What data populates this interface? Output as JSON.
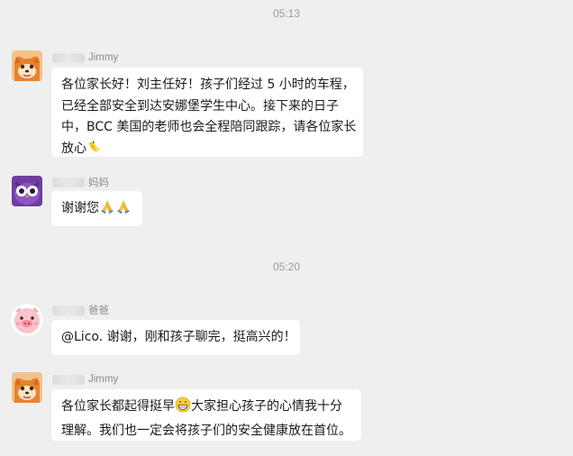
{
  "chat": {
    "timestamps": [
      "05:13",
      "05:20"
    ],
    "messages": [
      {
        "sender": "Jimmy",
        "lines": [
          "各位家长好！刘主任好！孩子们经过 5 小时的车程，",
          "已经全部安全到达安娜堡学生中心。接下来的日子",
          "中，BCC 美国的老师也会全程陪同跟踪，请各位家长",
          "放心"
        ],
        "emoji": "banana-icon"
      },
      {
        "sender": "妈妈",
        "lines": [
          "谢谢您"
        ],
        "emoji": "praying-hands-icon"
      },
      {
        "sender": "爸爸",
        "lines": [
          "@Lico. 谢谢，刚和孩子聊完，挺高兴的！"
        ]
      },
      {
        "sender": "Jimmy",
        "lines": [
          "各位家长都起得挺早",
          "大家担心孩子的心情我十分",
          "理解。我们也一定会将孩子们的安全健康放在首位。"
        ],
        "emoji": "grinning-face-icon"
      }
    ]
  },
  "colors": {
    "background": "#efefef",
    "bubble": "#ffffff",
    "timestamp": "#9b9b9b"
  }
}
